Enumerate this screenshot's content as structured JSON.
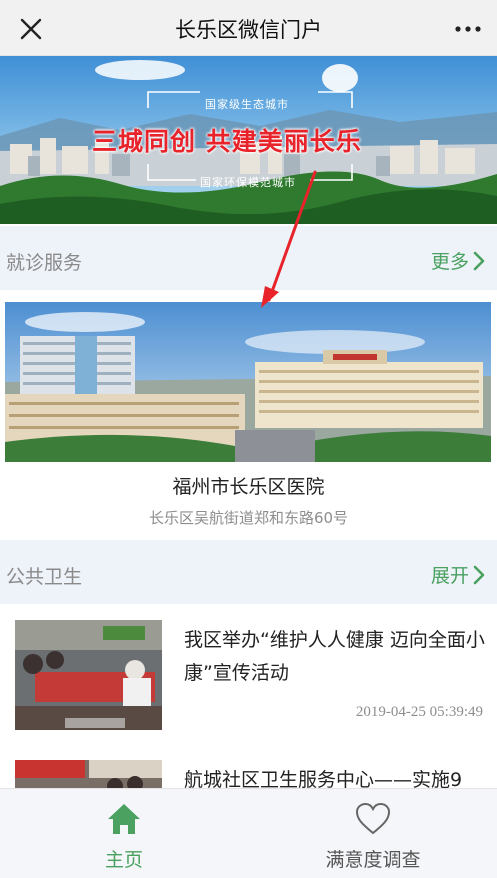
{
  "header": {
    "title": "长乐区微信门户"
  },
  "banner": {
    "tag_top": "国家级生态城市",
    "slogan": "三城同创  共建美丽长乐",
    "tag_bottom": "国家环保模范城市"
  },
  "clinic_section": {
    "label": "就诊服务",
    "link": "更多"
  },
  "hospital": {
    "name": "福州市长乐区医院",
    "address": "长乐区吴航街道郑和东路60号"
  },
  "public_health_section": {
    "label": "公共卫生",
    "link": "展开"
  },
  "news": [
    {
      "title": "我区举办“维护人人健康 迈向全面小康”宣传活动",
      "time": "2019-04-25 05:39:49"
    },
    {
      "title": "航城社区卫生服务中心——实施9"
    }
  ],
  "tabbar": {
    "home": "主页",
    "survey": "满意度调查"
  },
  "colors": {
    "accent": "#4aa160",
    "slogan": "#e8232a",
    "arrow": "#e8232a"
  }
}
